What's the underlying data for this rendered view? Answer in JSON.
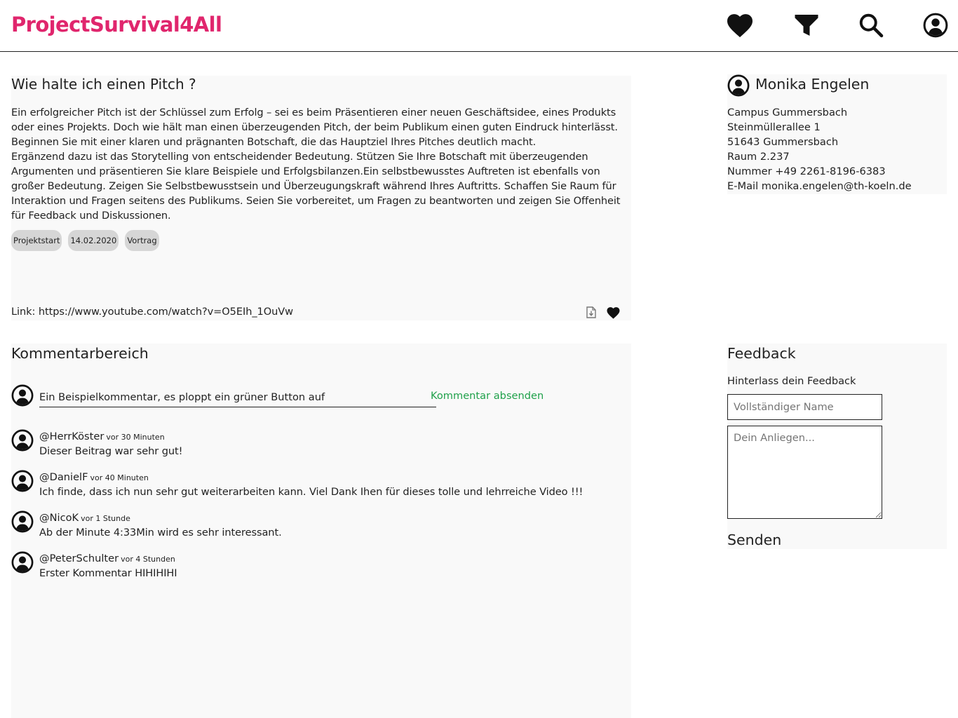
{
  "header": {
    "logo": "ProjectSurvival4All",
    "accent_color": "#e0266d",
    "icons": [
      "heart-icon",
      "filter-icon",
      "search-icon",
      "account-icon"
    ]
  },
  "article": {
    "title": "Wie halte ich einen Pitch ?",
    "body": "Ein erfolgreicher Pitch ist der Schlüssel zum Erfolg – sei es beim Präsentieren einer neuen Geschäftsidee, eines Produkts oder eines Projekts. Doch wie hält man einen überzeugenden Pitch, der beim Publikum einen guten Eindruck hinterlässt. Beginnen Sie mit einer klaren und prägnanten Botschaft, die das Hauptziel Ihres Pitches deutlich macht.\nErgänzend dazu ist das Storytelling von entscheidender Bedeutung. Stützen Sie Ihre Botschaft mit überzeugenden Argumenten und präsentieren Sie klare Beispiele und Erfolgsbilanzen.Ein selbstbewusstes Auftreten ist ebenfalls von großer Bedeutung. Zeigen Sie Selbstbewusstsein und Überzeugungskraft während Ihres Auftritts. Schaffen Sie Raum für Interaktion und Fragen seitens des Publikums. Seien Sie vorbereitet, um Fragen zu beantworten und zeigen Sie Offenheit für Feedback und Diskussionen.",
    "tags": [
      "Projektstart",
      "14.02.2020",
      "Vortrag"
    ],
    "link": "Link: https://www.youtube.com/watch?v=O5EIh_1OuVw",
    "download_icon": "download-file-icon",
    "favorite_icon": "heart-icon"
  },
  "contact": {
    "name": "Monika Engelen",
    "lines": [
      "Campus Gummersbach",
      "Steinmüllerallee 1",
      "51643 Gummersbach",
      "Raum 2.237",
      "Nummer +49 2261-8196-6383",
      "E-Mail monika.engelen@th-koeln.de"
    ]
  },
  "comments": {
    "title": "Kommentarbereich",
    "input_value": "Ein Beispielkommentar, es ploppt ein grüner Button auf",
    "send_label": "Kommentar absenden",
    "send_color": "#1fa14a",
    "items": [
      {
        "user": "@HerrKöster",
        "time": "vor 30 Minuten",
        "text": "Dieser Beitrag war sehr gut!"
      },
      {
        "user": "@DanielF",
        "time": "vor 40 Minuten",
        "text": "Ich finde, dass ich nun sehr gut weiterarbeiten kann. Viel Dank Ihen für dieses tolle und lehrreiche Video !!!"
      },
      {
        "user": "@NicoK",
        "time": "vor 1 Stunde",
        "text": "Ab der Minute 4:33Min wird es sehr interessant."
      },
      {
        "user": "@PeterSchulter",
        "time": "vor 4 Stunden",
        "text": "Erster Kommentar HIHIHIHI"
      }
    ]
  },
  "feedback": {
    "title": "Feedback",
    "subtitle": "Hinterlass dein Feedback",
    "name_placeholder": "Vollständiger Name",
    "message_placeholder": "Dein Anliegen...",
    "send_label": "Senden"
  }
}
